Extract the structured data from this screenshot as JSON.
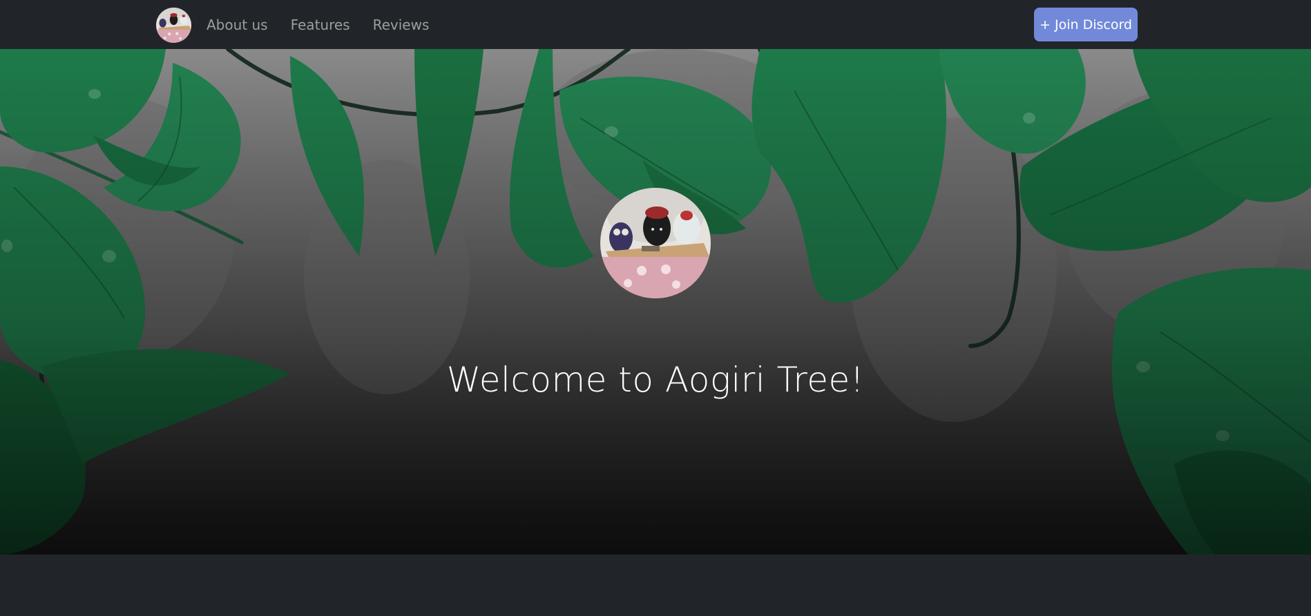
{
  "navbar": {
    "logo_icon": "aogiri-avatar-icon",
    "links": [
      {
        "label": "About us"
      },
      {
        "label": "Features"
      },
      {
        "label": "Reviews"
      }
    ],
    "join_button_label": "+ Join Discord"
  },
  "hero": {
    "background": "jungle-leaves-illustration",
    "avatar_icon": "aogiri-avatar-icon",
    "title": "Welcome to Aogiri Tree!"
  },
  "colors": {
    "navbar_bg": "#212529",
    "accent": "#7289da",
    "nav_link": "rgba(255,255,255,0.55)",
    "leaf_green": "#1e7a4a"
  }
}
